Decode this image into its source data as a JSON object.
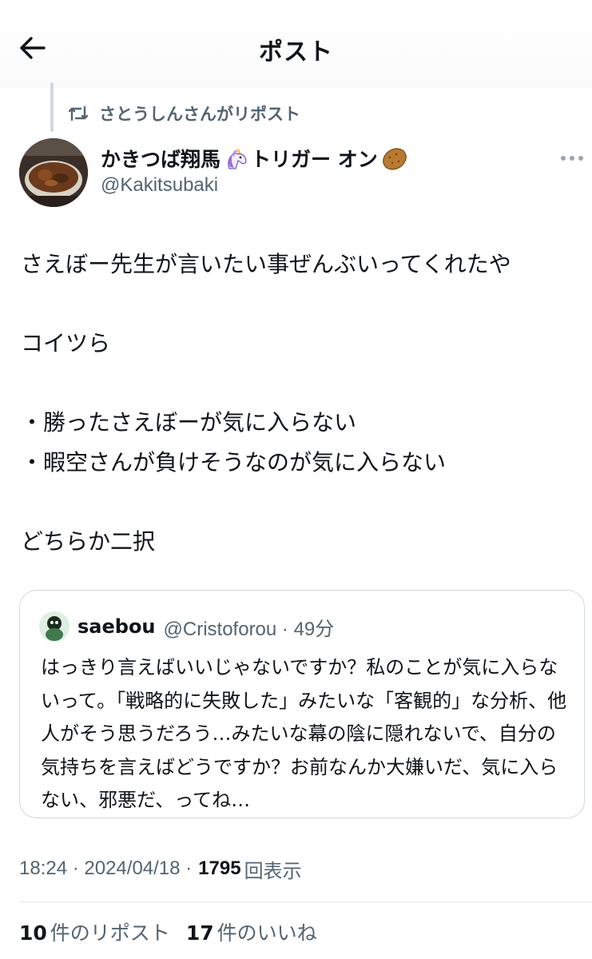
{
  "header": {
    "title": "ポスト"
  },
  "repost": {
    "label": "さとうしんさんがリポスト"
  },
  "author": {
    "name_prefix": "かきつば翔馬",
    "name_middle": "トリガー オン",
    "handle": "@Kakitsubaki"
  },
  "post": {
    "text": "さえぼー先生が言いたい事ぜんぶいってくれたや\n\nコイツら\n\n・勝ったさえぼーが気に入らない\n・暇空さんが負けそうなのが気に入らない\n\nどちらか二択"
  },
  "quote": {
    "name": "saebou",
    "handle_time": "@Cristoforou · 49分",
    "text": "はっきり言えばいいじゃないですか？私のことが気に入らないって。「戦略的に失敗した」みたいな「客観的」な分析、他人がそう思うだろう…みたいな幕の陰に隠れないで、自分の気持ちを言えばどうですか？お前なんか大嫌いだ、気に入らない、邪悪だ、ってね…"
  },
  "meta": {
    "time_date": "18:24 · 2024/04/18 ·",
    "views_count": "1795",
    "views_label": "回表示"
  },
  "stats": {
    "reposts_count": "10",
    "reposts_label": "件のリポスト",
    "likes_count": "17",
    "likes_label": "件のいいね"
  },
  "icons": {
    "back": "arrow-left-icon",
    "repost": "repost-icon",
    "more": "more-dots-icon",
    "unicorn": "unicorn-emoji-icon",
    "potato": "potato-emoji-icon"
  },
  "colors": {
    "text": "#0f1419",
    "secondary": "#536471",
    "border": "#cfd9de"
  }
}
